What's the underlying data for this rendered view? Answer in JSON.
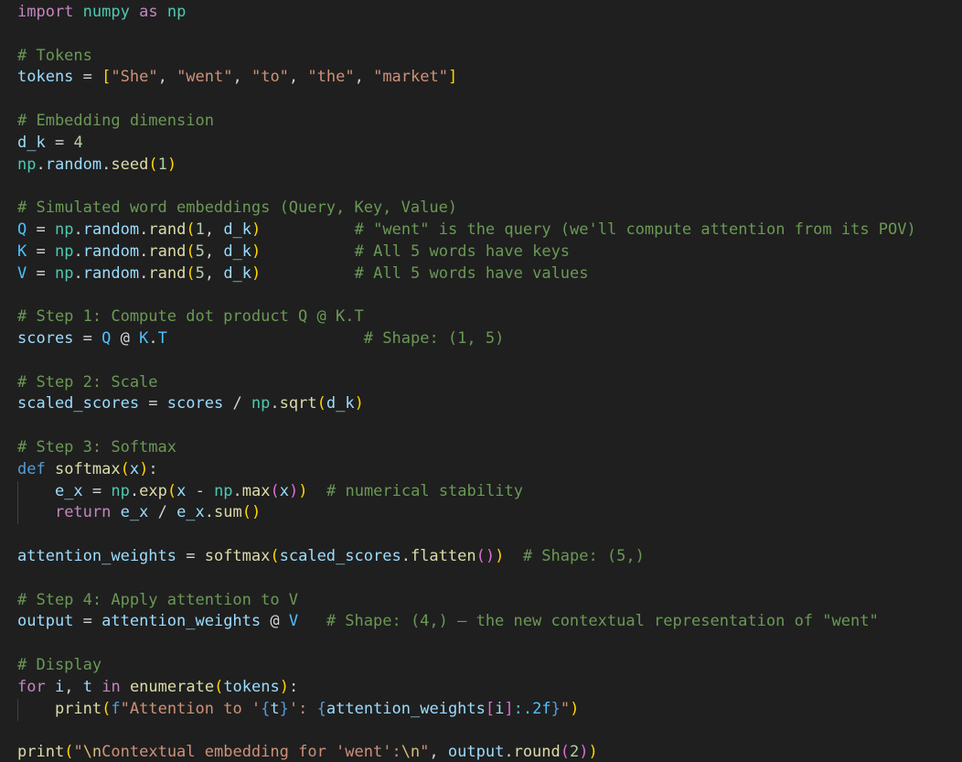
{
  "editor": {
    "language": "python",
    "lines": [
      [
        [
          "import",
          "kw"
        ],
        [
          " ",
          "op"
        ],
        [
          "numpy",
          "cls"
        ],
        [
          " ",
          "op"
        ],
        [
          "as",
          "kw"
        ],
        [
          " ",
          "op"
        ],
        [
          "np",
          "cls"
        ]
      ],
      [],
      [
        [
          "# Tokens",
          "com"
        ]
      ],
      [
        [
          "tokens",
          "var"
        ],
        [
          " = ",
          "op"
        ],
        [
          "[",
          "b1"
        ],
        [
          "\"She\"",
          "str"
        ],
        [
          ", ",
          "op"
        ],
        [
          "\"went\"",
          "str"
        ],
        [
          ", ",
          "op"
        ],
        [
          "\"to\"",
          "str"
        ],
        [
          ", ",
          "op"
        ],
        [
          "\"the\"",
          "str"
        ],
        [
          ", ",
          "op"
        ],
        [
          "\"market\"",
          "str"
        ],
        [
          "]",
          "b1"
        ]
      ],
      [],
      [
        [
          "# Embedding dimension",
          "com"
        ]
      ],
      [
        [
          "d_k",
          "var"
        ],
        [
          " = ",
          "op"
        ],
        [
          "4",
          "num"
        ]
      ],
      [
        [
          "np",
          "cls"
        ],
        [
          ".",
          "op"
        ],
        [
          "random",
          "var"
        ],
        [
          ".",
          "op"
        ],
        [
          "seed",
          "fn"
        ],
        [
          "(",
          "b1"
        ],
        [
          "1",
          "num"
        ],
        [
          ")",
          "b1"
        ]
      ],
      [],
      [
        [
          "# Simulated word embeddings (Query, Key, Value)",
          "com"
        ]
      ],
      [
        [
          "Q",
          "con"
        ],
        [
          " = ",
          "op"
        ],
        [
          "np",
          "cls"
        ],
        [
          ".",
          "op"
        ],
        [
          "random",
          "var"
        ],
        [
          ".",
          "op"
        ],
        [
          "rand",
          "fn"
        ],
        [
          "(",
          "b1"
        ],
        [
          "1",
          "num"
        ],
        [
          ", ",
          "op"
        ],
        [
          "d_k",
          "var"
        ],
        [
          ")",
          "b1"
        ],
        [
          "          ",
          "op"
        ],
        [
          "# \"went\" is the query (we'll compute attention from its POV)",
          "com"
        ]
      ],
      [
        [
          "K",
          "con"
        ],
        [
          " = ",
          "op"
        ],
        [
          "np",
          "cls"
        ],
        [
          ".",
          "op"
        ],
        [
          "random",
          "var"
        ],
        [
          ".",
          "op"
        ],
        [
          "rand",
          "fn"
        ],
        [
          "(",
          "b1"
        ],
        [
          "5",
          "num"
        ],
        [
          ", ",
          "op"
        ],
        [
          "d_k",
          "var"
        ],
        [
          ")",
          "b1"
        ],
        [
          "          ",
          "op"
        ],
        [
          "# All 5 words have keys",
          "com"
        ]
      ],
      [
        [
          "V",
          "con"
        ],
        [
          " = ",
          "op"
        ],
        [
          "np",
          "cls"
        ],
        [
          ".",
          "op"
        ],
        [
          "random",
          "var"
        ],
        [
          ".",
          "op"
        ],
        [
          "rand",
          "fn"
        ],
        [
          "(",
          "b1"
        ],
        [
          "5",
          "num"
        ],
        [
          ", ",
          "op"
        ],
        [
          "d_k",
          "var"
        ],
        [
          ")",
          "b1"
        ],
        [
          "          ",
          "op"
        ],
        [
          "# All 5 words have values",
          "com"
        ]
      ],
      [],
      [
        [
          "# Step 1: Compute dot product Q @ K.T",
          "com"
        ]
      ],
      [
        [
          "scores",
          "var"
        ],
        [
          " = ",
          "op"
        ],
        [
          "Q",
          "con"
        ],
        [
          " @ ",
          "op"
        ],
        [
          "K",
          "con"
        ],
        [
          ".",
          "op"
        ],
        [
          "T",
          "con"
        ],
        [
          "                     ",
          "op"
        ],
        [
          "# Shape: (1, 5)",
          "com"
        ]
      ],
      [],
      [
        [
          "# Step 2: Scale",
          "com"
        ]
      ],
      [
        [
          "scaled_scores",
          "var"
        ],
        [
          " = ",
          "op"
        ],
        [
          "scores",
          "var"
        ],
        [
          " / ",
          "op"
        ],
        [
          "np",
          "cls"
        ],
        [
          ".",
          "op"
        ],
        [
          "sqrt",
          "fn"
        ],
        [
          "(",
          "b1"
        ],
        [
          "d_k",
          "var"
        ],
        [
          ")",
          "b1"
        ]
      ],
      [],
      [
        [
          "# Step 3: Softmax",
          "com"
        ]
      ],
      [
        [
          "def",
          "kw2"
        ],
        [
          " ",
          "op"
        ],
        [
          "softmax",
          "fn"
        ],
        [
          "(",
          "b1"
        ],
        [
          "x",
          "var"
        ],
        [
          ")",
          "b1"
        ],
        [
          ":",
          "op"
        ]
      ],
      [
        [
          "    ",
          "op"
        ],
        [
          "e_x",
          "var"
        ],
        [
          " = ",
          "op"
        ],
        [
          "np",
          "cls"
        ],
        [
          ".",
          "op"
        ],
        [
          "exp",
          "fn"
        ],
        [
          "(",
          "b1"
        ],
        [
          "x",
          "var"
        ],
        [
          " - ",
          "op"
        ],
        [
          "np",
          "cls"
        ],
        [
          ".",
          "op"
        ],
        [
          "max",
          "fn"
        ],
        [
          "(",
          "b2"
        ],
        [
          "x",
          "var"
        ],
        [
          ")",
          "b2"
        ],
        [
          ")",
          "b1"
        ],
        [
          "  ",
          "op"
        ],
        [
          "# numerical stability",
          "com"
        ]
      ],
      [
        [
          "    ",
          "op"
        ],
        [
          "return",
          "kw"
        ],
        [
          " ",
          "op"
        ],
        [
          "e_x",
          "var"
        ],
        [
          " / ",
          "op"
        ],
        [
          "e_x",
          "var"
        ],
        [
          ".",
          "op"
        ],
        [
          "sum",
          "fn"
        ],
        [
          "()",
          "b1"
        ]
      ],
      [],
      [
        [
          "attention_weights",
          "var"
        ],
        [
          " = ",
          "op"
        ],
        [
          "softmax",
          "fn"
        ],
        [
          "(",
          "b1"
        ],
        [
          "scaled_scores",
          "var"
        ],
        [
          ".",
          "op"
        ],
        [
          "flatten",
          "fn"
        ],
        [
          "()",
          "b2"
        ],
        [
          ")",
          "b1"
        ],
        [
          "  ",
          "op"
        ],
        [
          "# Shape: (5,)",
          "com"
        ]
      ],
      [],
      [
        [
          "# Step 4: Apply attention to V",
          "com"
        ]
      ],
      [
        [
          "output",
          "var"
        ],
        [
          " = ",
          "op"
        ],
        [
          "attention_weights",
          "var"
        ],
        [
          " @ ",
          "op"
        ],
        [
          "V",
          "con"
        ],
        [
          "   ",
          "op"
        ],
        [
          "# Shape: (4,) — the new contextual representation of \"went\"",
          "com"
        ]
      ],
      [],
      [
        [
          "# Display",
          "com"
        ]
      ],
      [
        [
          "for",
          "kw"
        ],
        [
          " ",
          "op"
        ],
        [
          "i",
          "var"
        ],
        [
          ", ",
          "op"
        ],
        [
          "t",
          "var"
        ],
        [
          " ",
          "op"
        ],
        [
          "in",
          "kw"
        ],
        [
          " ",
          "op"
        ],
        [
          "enumerate",
          "fn"
        ],
        [
          "(",
          "b1"
        ],
        [
          "tokens",
          "var"
        ],
        [
          ")",
          "b1"
        ],
        [
          ":",
          "op"
        ]
      ],
      [
        [
          "    ",
          "op"
        ],
        [
          "print",
          "fn"
        ],
        [
          "(",
          "b1"
        ],
        [
          "f",
          "kw2"
        ],
        [
          "\"Attention to '",
          "str"
        ],
        [
          "{",
          "kw2"
        ],
        [
          "t",
          "var"
        ],
        [
          "}",
          "kw2"
        ],
        [
          "': ",
          "str"
        ],
        [
          "{",
          "kw2"
        ],
        [
          "attention_weights",
          "var"
        ],
        [
          "[",
          "b2"
        ],
        [
          "i",
          "var"
        ],
        [
          "]",
          "b2"
        ],
        [
          ":.2f",
          "con"
        ],
        [
          "}",
          "kw2"
        ],
        [
          "\"",
          "str"
        ],
        [
          ")",
          "b1"
        ]
      ],
      [],
      [
        [
          "print",
          "fn"
        ],
        [
          "(",
          "b1"
        ],
        [
          "\"",
          "str"
        ],
        [
          "\\n",
          "esc"
        ],
        [
          "Contextual embedding for 'went':",
          "str"
        ],
        [
          "\\n",
          "esc"
        ],
        [
          "\"",
          "str"
        ],
        [
          ", ",
          "op"
        ],
        [
          "output",
          "var"
        ],
        [
          ".",
          "op"
        ],
        [
          "round",
          "fn"
        ],
        [
          "(",
          "b2"
        ],
        [
          "2",
          "num"
        ],
        [
          ")",
          "b2"
        ],
        [
          ")",
          "b1"
        ]
      ]
    ]
  }
}
